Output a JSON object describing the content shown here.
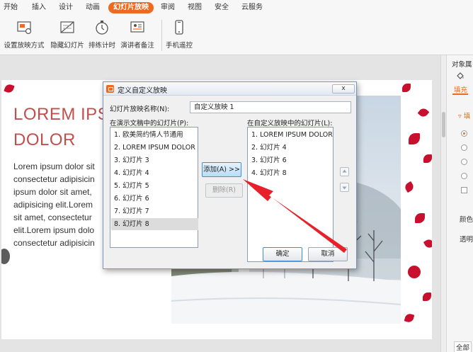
{
  "menubar": {
    "tabs": [
      {
        "label": "开始",
        "active": false
      },
      {
        "label": "插入",
        "active": false
      },
      {
        "label": "设计",
        "active": false
      },
      {
        "label": "动画",
        "active": false
      },
      {
        "label": "幻灯片放映",
        "active": true
      },
      {
        "label": "审阅",
        "active": false
      },
      {
        "label": "视图",
        "active": false
      },
      {
        "label": "安全",
        "active": false
      },
      {
        "label": "云服务",
        "active": false
      }
    ]
  },
  "toolbar": {
    "setup_show": "设置放映方式",
    "hide_slide": "隐藏幻灯片",
    "rehearse": "排练计时",
    "presenter_notes": "演讲者备注",
    "phone_remote": "手机遥控"
  },
  "slide": {
    "title_line1": "LOREM IPS",
    "title_line2": "DOLOR",
    "body_lines": [
      "Lorem ipsum dolor sit",
      "consectetur adipisicin",
      "ipsum dolor sit amet,",
      "adipisicing elit.Lorem",
      "sit amet, consectetur",
      "elit.Lorem ipsum dolo",
      "consectetur adipisicin"
    ]
  },
  "panel": {
    "title": "对象属",
    "tab_fill": "填充",
    "section": "▿ 填",
    "color_label": "颜色",
    "transparency_label": "透明",
    "bottom_field": "全部"
  },
  "dialog": {
    "title": "定义自定义放映",
    "close_label": "x",
    "name_label": "幻灯片放映名称(N):",
    "name_value": "自定义放映 1",
    "left_list_label": "在演示文稿中的幻灯片(P):",
    "right_list_label": "在自定义放映中的幻灯片(L):",
    "left_items": [
      "1. 欧美简约情人节通用",
      "2. LOREM IPSUM DOLOR",
      "3. 幻灯片 3",
      "4. 幻灯片 4",
      "5. 幻灯片 5",
      "6. 幻灯片 6",
      "7. 幻灯片 7",
      "8. 幻灯片 8"
    ],
    "right_items": [
      "1. LOREM IPSUM DOLOR",
      "2. 幻灯片 4",
      "3. 幻灯片 6",
      "4. 幻灯片 8"
    ],
    "add_button": "添加(A) >>",
    "remove_button": "删除(R)",
    "ok_button": "确定",
    "cancel_button": "取消"
  },
  "colors": {
    "accent": "#ef6a1e",
    "title_red": "#c0504d",
    "annotation_arrow": "#e8202a"
  }
}
